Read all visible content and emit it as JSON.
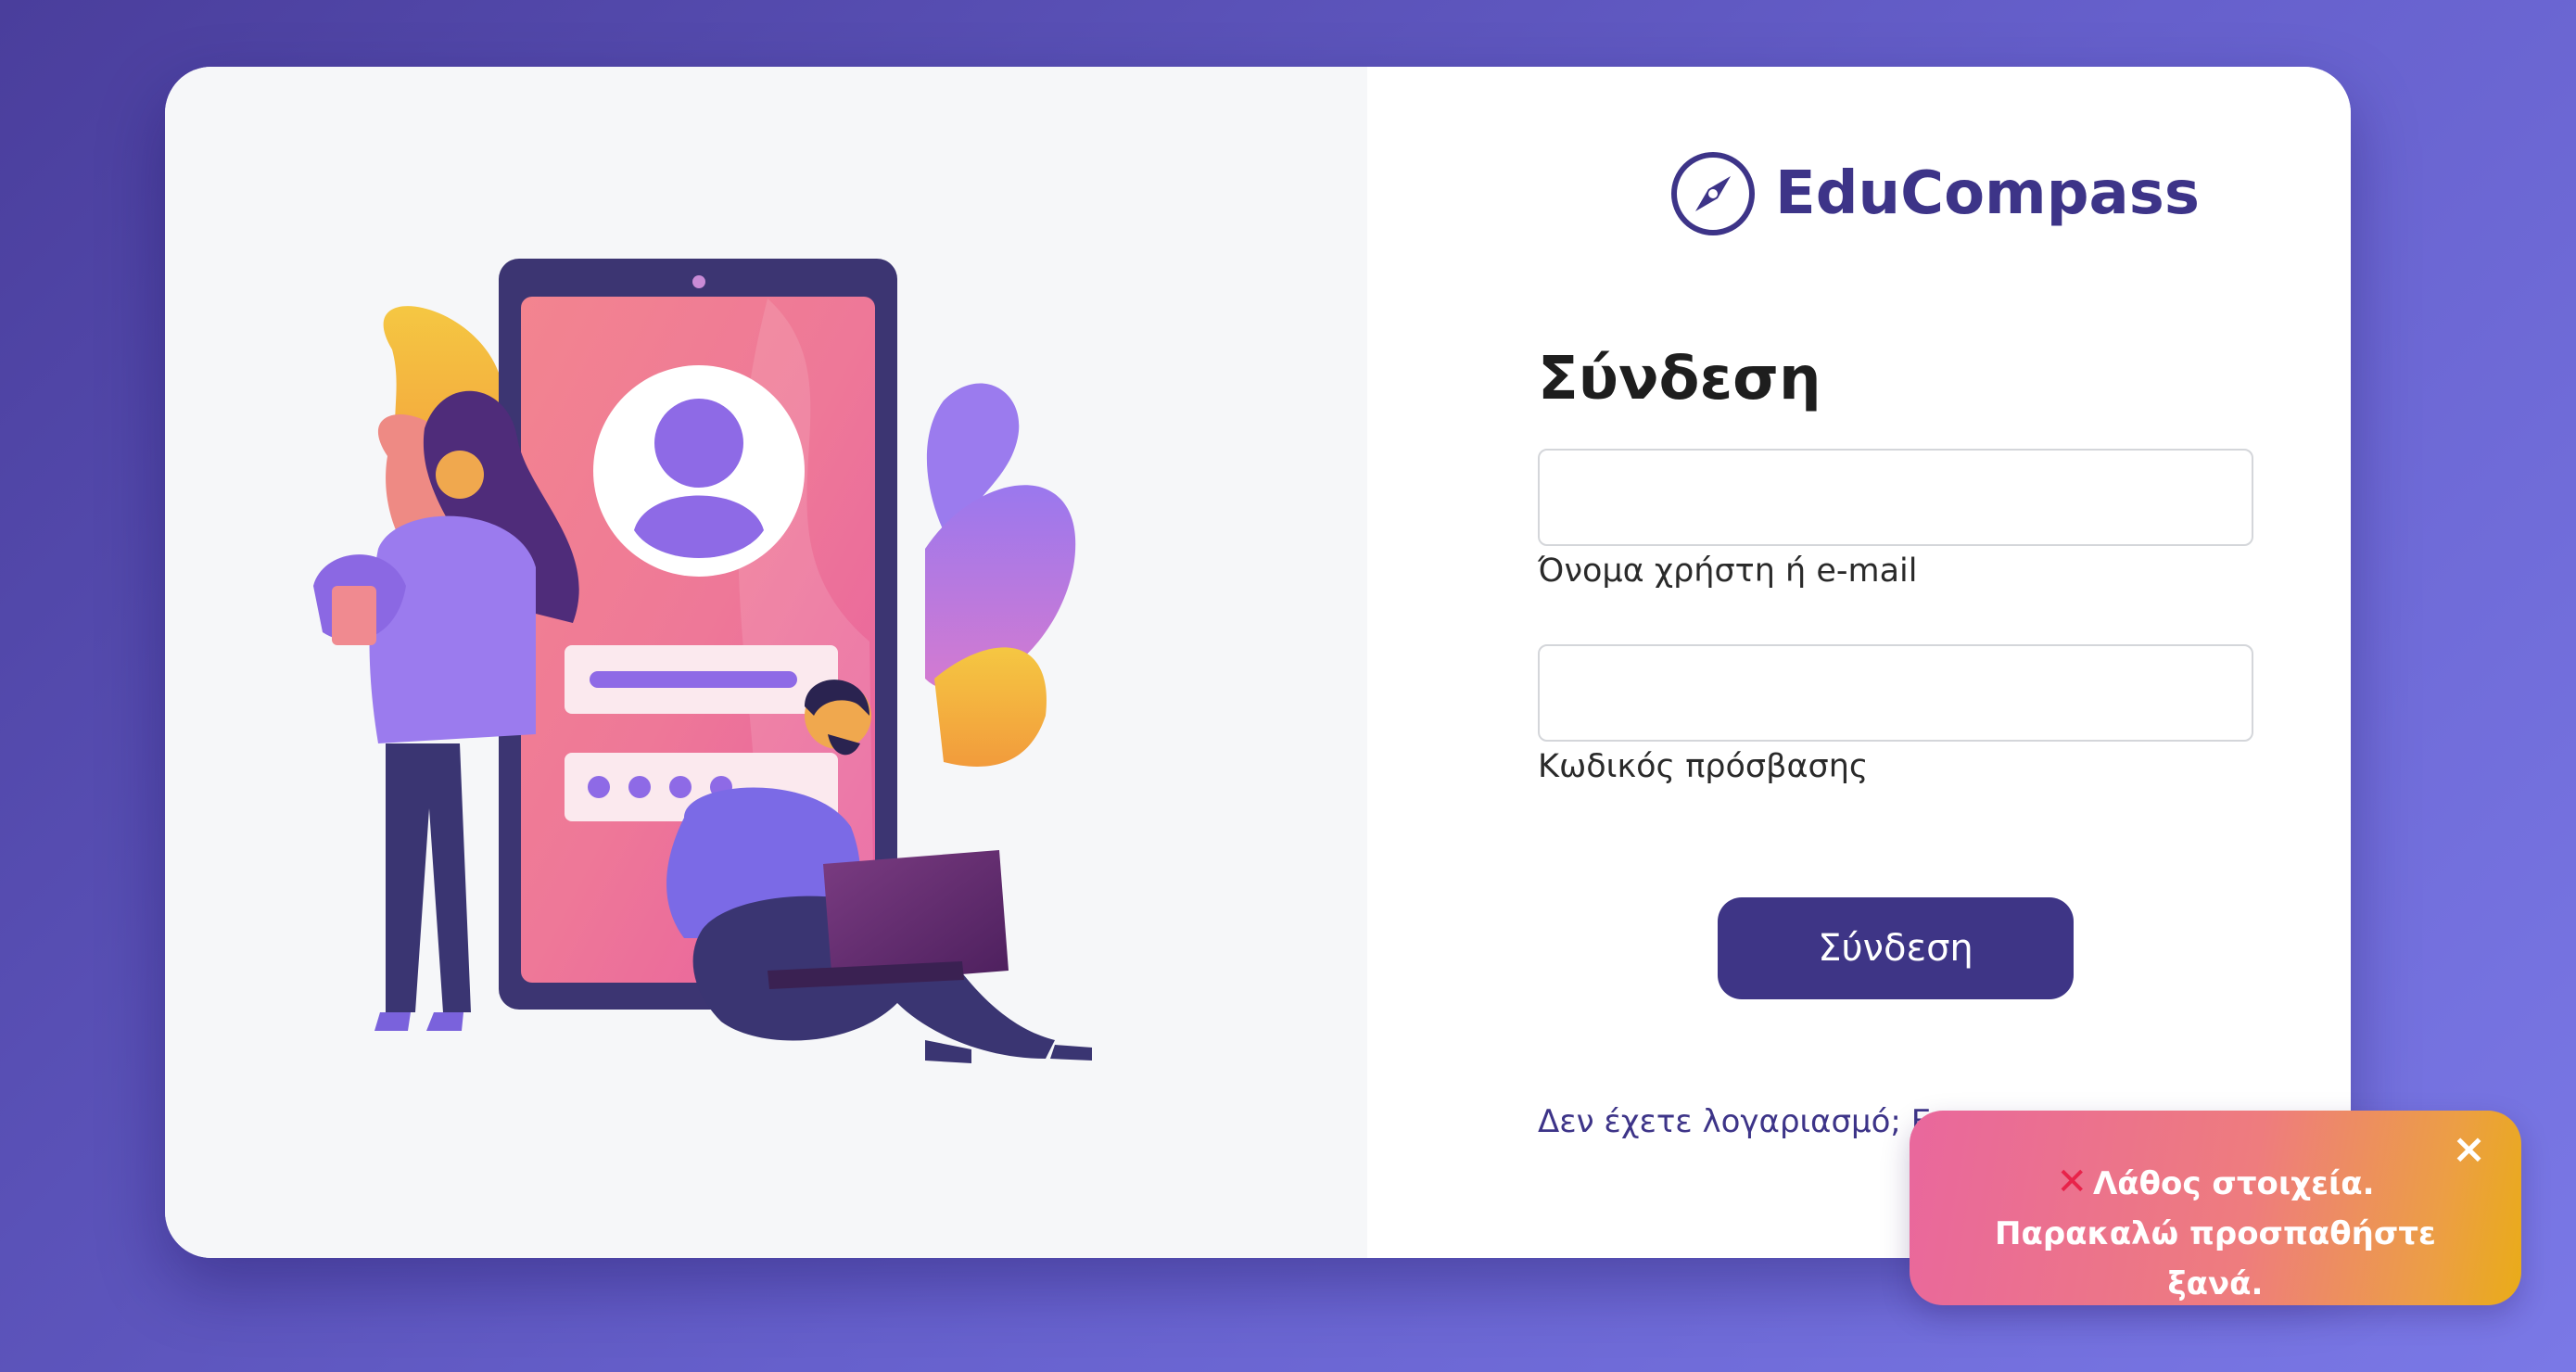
{
  "brand": {
    "name": "EduCompass",
    "icon": "compass-icon"
  },
  "form": {
    "title": "Σύνδεση",
    "username": {
      "value": "",
      "label": "Όνομα χρήστη ή e-mail"
    },
    "password": {
      "value": "",
      "label": "Κωδικός πρόσβασης"
    },
    "submit_label": "Σύνδεση",
    "signup_prompt": "Δεν έχετε λογαριασμό;",
    "signup_link": "Εγγ"
  },
  "toast": {
    "icon": "error-x-icon",
    "message": "Λάθος στοιχεία. Παρακαλώ προσπαθήστε ξανά.",
    "close_label": "×"
  },
  "colors": {
    "brand": "#3d3488",
    "button": "#3e3586",
    "error_x": "#e8234a"
  }
}
